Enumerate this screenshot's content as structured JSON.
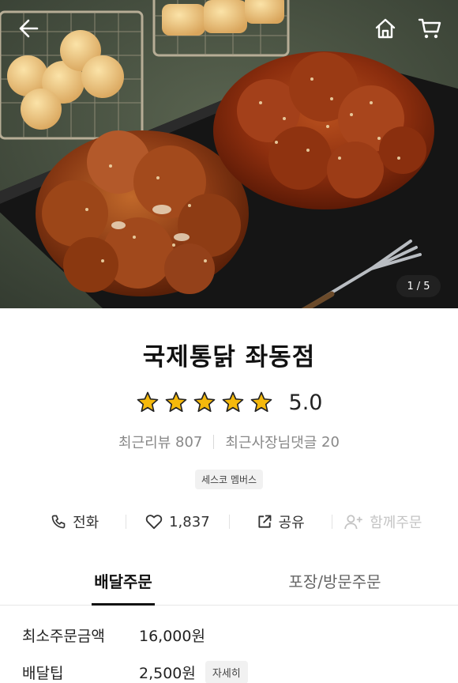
{
  "hero": {
    "pager_current": "1",
    "pager_sep": "/",
    "pager_total": "5",
    "icons": {
      "back": "arrow-left-icon",
      "home": "home-icon",
      "cart": "cart-icon"
    }
  },
  "store": {
    "name": "국제통닭 좌동점",
    "rating": "5.0",
    "star_count": 5,
    "star_color": "#f5b90b",
    "recent_review_label": "최근리뷰",
    "recent_review_count": "807",
    "owner_reply_label": "최근사장님댓글",
    "owner_reply_count": "20",
    "badge": "세스코 멤버스"
  },
  "actions": {
    "call": {
      "label": "전화",
      "icon": "phone-icon"
    },
    "like": {
      "count": "1,837",
      "icon": "heart-icon"
    },
    "share": {
      "label": "공유",
      "icon": "share-icon"
    },
    "group_order": {
      "label": "함께주문",
      "icon": "add-user-icon"
    }
  },
  "tabs": {
    "delivery": "배달주문",
    "pickup": "포장/방문주문"
  },
  "info": {
    "min_order_label": "최소주문금액",
    "min_order_value": "16,000원",
    "delivery_tip_label": "배달팁",
    "delivery_tip_value": "2,500원",
    "detail_button": "자세히"
  }
}
